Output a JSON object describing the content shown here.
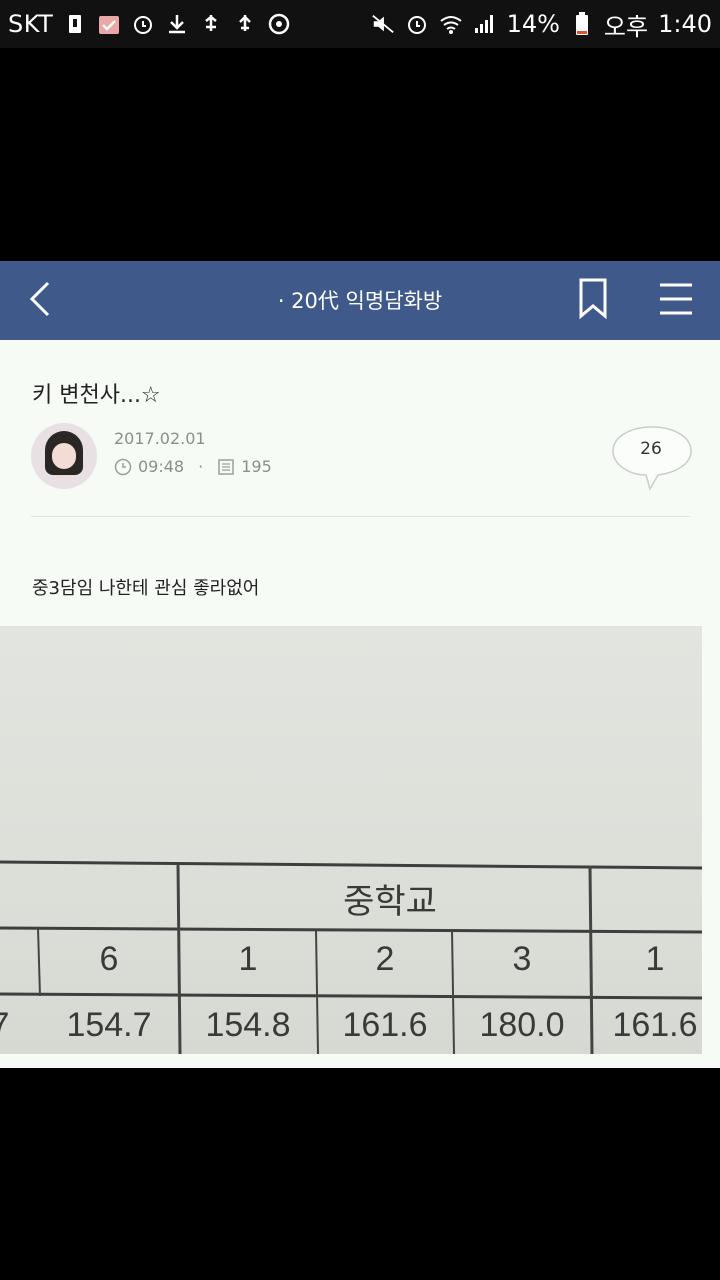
{
  "status_bar": {
    "carrier": "SKT",
    "battery": "14%",
    "ampm": "오후",
    "time": "1:40"
  },
  "header": {
    "title": "· 20代 익명담화방"
  },
  "post": {
    "title": "키 변천사...☆",
    "date": "2017.02.01",
    "time": "09:48",
    "views": "195",
    "comment_count": "26",
    "body": "중3담임 나한테 관심 좋라없어"
  },
  "photo_table": {
    "header_group": "중학교",
    "grades": [
      "6",
      "1",
      "2",
      "3",
      "1"
    ],
    "heights": [
      "7",
      "154.7",
      "154.8",
      "161.6",
      "180.0",
      "161.6"
    ]
  },
  "colors": {
    "appbar": "#3f5a8a",
    "background": "#f7fbf6"
  }
}
